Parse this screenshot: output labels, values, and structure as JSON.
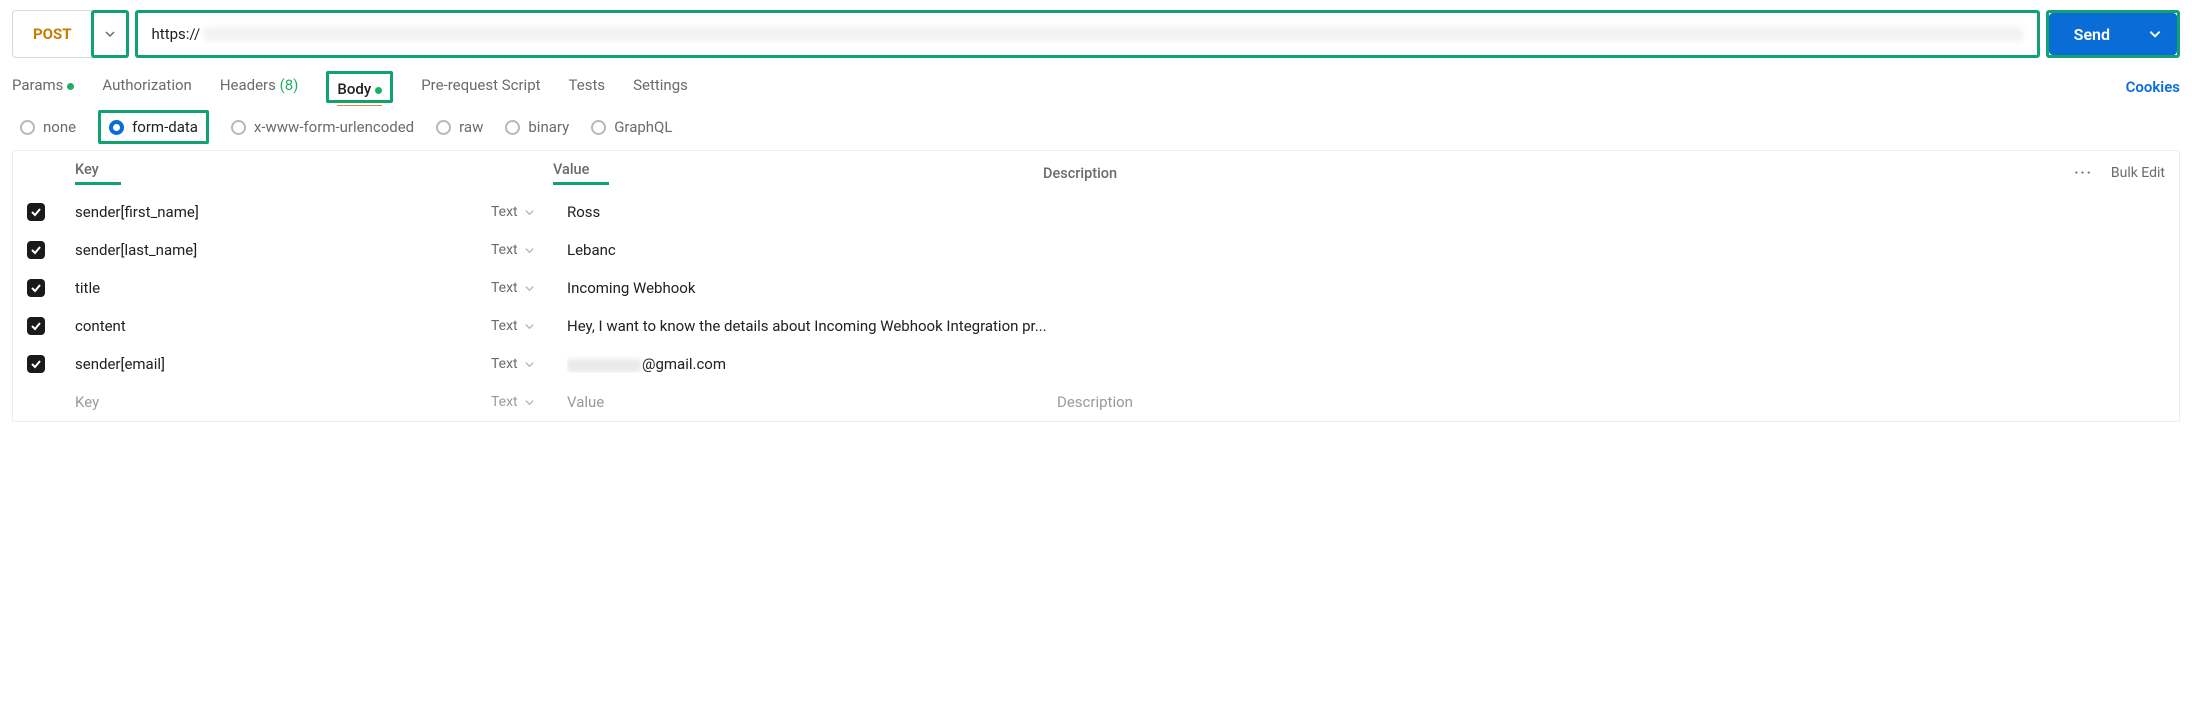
{
  "request": {
    "method": "POST",
    "url_prefix": "https://",
    "send_label": "Send"
  },
  "tabs": {
    "params": "Params",
    "authorization": "Authorization",
    "headers": "Headers",
    "headers_count": "(8)",
    "body": "Body",
    "prerequest": "Pre-request Script",
    "tests": "Tests",
    "settings": "Settings",
    "cookies": "Cookies"
  },
  "body_types": {
    "none": "none",
    "formdata": "form-data",
    "urlencoded": "x-www-form-urlencoded",
    "raw": "raw",
    "binary": "binary",
    "graphql": "GraphQL"
  },
  "table": {
    "header_key": "Key",
    "header_value": "Value",
    "header_desc": "Description",
    "bulk_edit": "Bulk Edit",
    "type_label": "Text",
    "rows": [
      {
        "key": "sender[first_name]",
        "value": "Ross"
      },
      {
        "key": "sender[last_name]",
        "value": "Lebanc"
      },
      {
        "key": "title",
        "value": "Incoming Webhook"
      },
      {
        "key": "content",
        "value": "Hey, I want to know the details about Incoming Webhook Integration pr..."
      },
      {
        "key": "sender[email]",
        "value": "@gmail.com",
        "email_blur": true
      }
    ],
    "placeholder": {
      "key": "Key",
      "value": "Value",
      "desc": "Description"
    }
  }
}
